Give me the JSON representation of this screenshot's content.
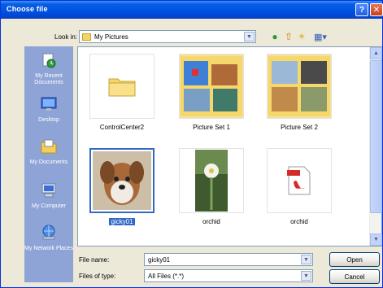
{
  "window": {
    "title": "Choose file"
  },
  "titlebar": {
    "help_glyph": "?",
    "close_glyph": "✕"
  },
  "toolbar": {
    "look_in_label": "Look in:",
    "look_in_value": "My Pictures",
    "icons": [
      "back-icon",
      "up-folder-icon",
      "new-folder-icon",
      "views-icon"
    ]
  },
  "places": [
    {
      "label": "My Recent Documents",
      "icon": "recent-documents-icon"
    },
    {
      "label": "Desktop",
      "icon": "desktop-icon"
    },
    {
      "label": "My Documents",
      "icon": "my-documents-icon"
    },
    {
      "label": "My Computer",
      "icon": "my-computer-icon"
    },
    {
      "label": "My Network Places",
      "icon": "network-places-icon"
    }
  ],
  "files": [
    {
      "name": "ControlCenter2",
      "kind": "folder"
    },
    {
      "name": "Picture Set 1",
      "kind": "photo-folder"
    },
    {
      "name": "Picture Set 2",
      "kind": "photo-folder"
    },
    {
      "name": "gicky01",
      "kind": "image",
      "selected": true
    },
    {
      "name": "orchid",
      "kind": "image"
    },
    {
      "name": "orchid",
      "kind": "pdf"
    }
  ],
  "bottom": {
    "file_name_label": "File name:",
    "file_name_value": "gicky01",
    "file_type_label": "Files of type:",
    "file_type_value": "All Files (*.*)",
    "open_label": "Open",
    "cancel_label": "Cancel"
  }
}
